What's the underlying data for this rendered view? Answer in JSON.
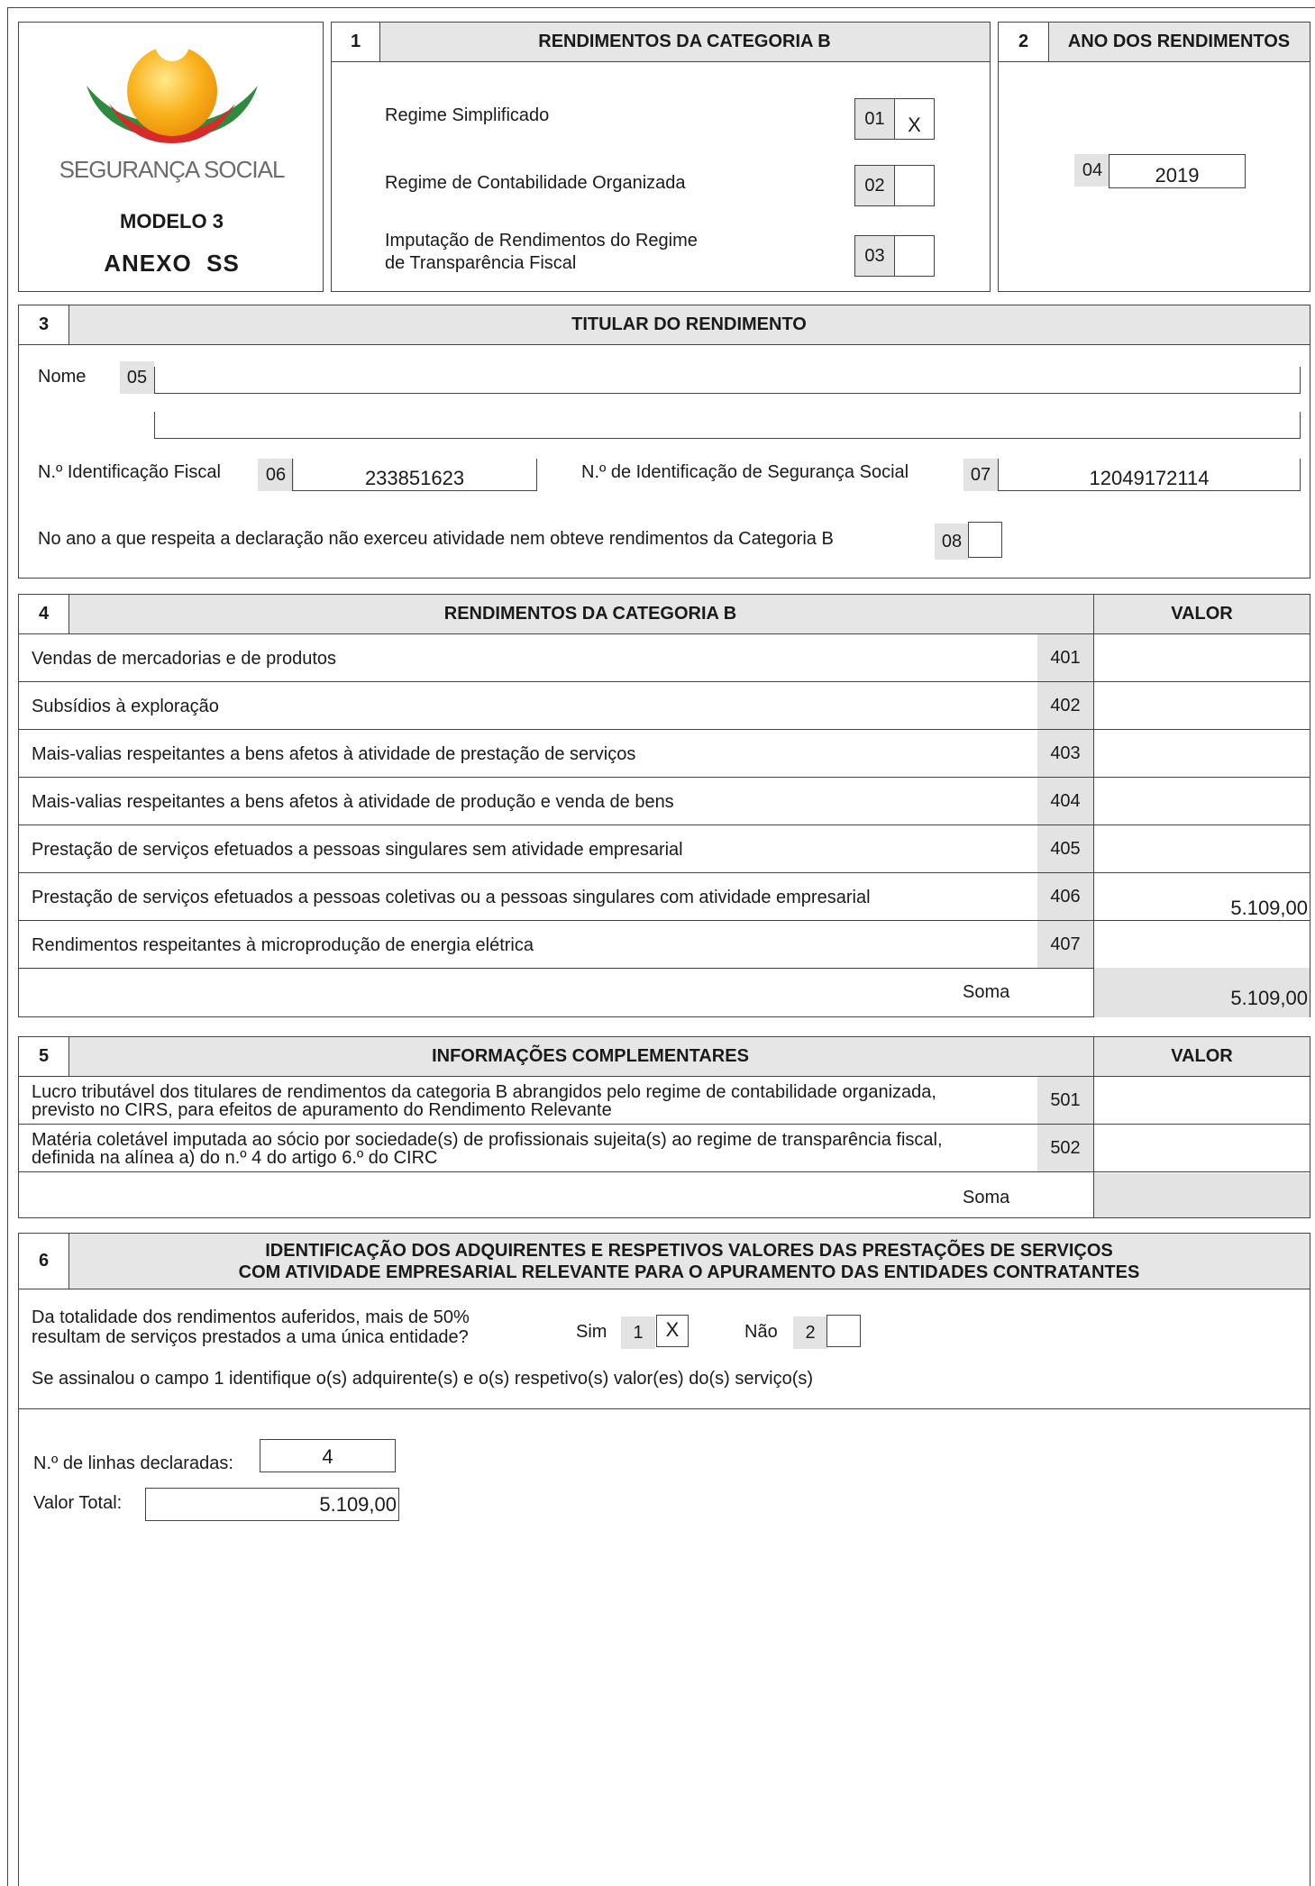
{
  "logo": {
    "brand": "SEGURANÇA SOCIAL",
    "model": "MODELO 3",
    "annex": "ANEXO  SS"
  },
  "section1": {
    "number": "1",
    "title": "RENDIMENTOS DA CATEGORIA B",
    "options": [
      {
        "label": "Regime Simplificado",
        "code": "01",
        "mark": "X"
      },
      {
        "label": "Regime de Contabilidade Organizada",
        "code": "02",
        "mark": ""
      },
      {
        "label_line1": "Imputação de Rendimentos do Regime",
        "label_line2": "de Transparência Fiscal",
        "code": "03",
        "mark": ""
      }
    ]
  },
  "section2": {
    "number": "2",
    "title": "ANO DOS RENDIMENTOS",
    "code": "04",
    "year": "2019"
  },
  "section3": {
    "number": "3",
    "title": "TITULAR DO RENDIMENTO",
    "name_label": "Nome",
    "name_code": "05",
    "name_value": "",
    "nif_label": "N.º Identificação Fiscal",
    "nif_code": "06",
    "nif_value": "233851623",
    "niss_label": "N.º de Identificação de Segurança Social",
    "niss_code": "07",
    "niss_value": "12049172114",
    "no_activity_label": "No ano a que respeita a declaração não exerceu atividade nem obteve rendimentos da Categoria B",
    "no_activity_code": "08",
    "no_activity_mark": ""
  },
  "section4": {
    "number": "4",
    "title": "RENDIMENTOS DA CATEGORIA B",
    "value_header": "VALOR",
    "rows": [
      {
        "label": "Vendas de mercadorias e de produtos",
        "code": "401",
        "value": ""
      },
      {
        "label": "Subsídios à exploração",
        "code": "402",
        "value": ""
      },
      {
        "label": "Mais-valias respeitantes a bens afetos à atividade de prestação de serviços",
        "code": "403",
        "value": ""
      },
      {
        "label": "Mais-valias respeitantes a bens afetos à atividade de produção e venda de bens",
        "code": "404",
        "value": ""
      },
      {
        "label": "Prestação de serviços efetuados a pessoas singulares sem atividade empresarial",
        "code": "405",
        "value": ""
      },
      {
        "label": "Prestação de serviços efetuados a pessoas coletivas ou a pessoas singulares com atividade empresarial",
        "code": "406",
        "value": "5.109,00"
      },
      {
        "label": "Rendimentos respeitantes à microprodução de energia elétrica",
        "code": "407",
        "value": ""
      }
    ],
    "sum_label": "Soma",
    "sum_value": "5.109,00"
  },
  "section5": {
    "number": "5",
    "title": "INFORMAÇÕES COMPLEMENTARES",
    "value_header": "VALOR",
    "rows": [
      {
        "line1": "Lucro tributável dos titulares de rendimentos da categoria B abrangidos pelo regime de contabilidade organizada,",
        "line2": "previsto no CIRS, para efeitos de apuramento do Rendimento Relevante",
        "code": "501",
        "value": ""
      },
      {
        "line1": "Matéria coletável imputada ao sócio por sociedade(s) de profissionais sujeita(s) ao regime de transparência fiscal,",
        "line2": "definida na alínea a) do n.º 4 do artigo 6.º do CIRC",
        "code": "502",
        "value": ""
      }
    ],
    "sum_label": "Soma",
    "sum_value": ""
  },
  "section6": {
    "number": "6",
    "title_line1": "IDENTIFICAÇÃO DOS ADQUIRENTES E RESPETIVOS VALORES DAS PRESTAÇÕES DE SERVIÇOS",
    "title_line2": "COM ATIVIDADE EMPRESARIAL RELEVANTE PARA O APURAMENTO DAS ENTIDADES CONTRATANTES",
    "question_line1": "Da totalidade dos rendimentos auferidos, mais de 50%",
    "question_line2": "resultam de serviços prestados a uma única entidade?",
    "yes_label": "Sim",
    "yes_code": "1",
    "yes_mark": "X",
    "no_label": "Não",
    "no_code": "2",
    "no_mark": "",
    "instruction": "Se assinalou o campo 1 identifique o(s) adquirente(s) e o(s) respetivo(s) valor(es) do(s) serviço(s)",
    "lines_label": "N.º de linhas declaradas:",
    "lines_value": "4",
    "total_label": "Valor Total:",
    "total_value": "5.109,00"
  }
}
